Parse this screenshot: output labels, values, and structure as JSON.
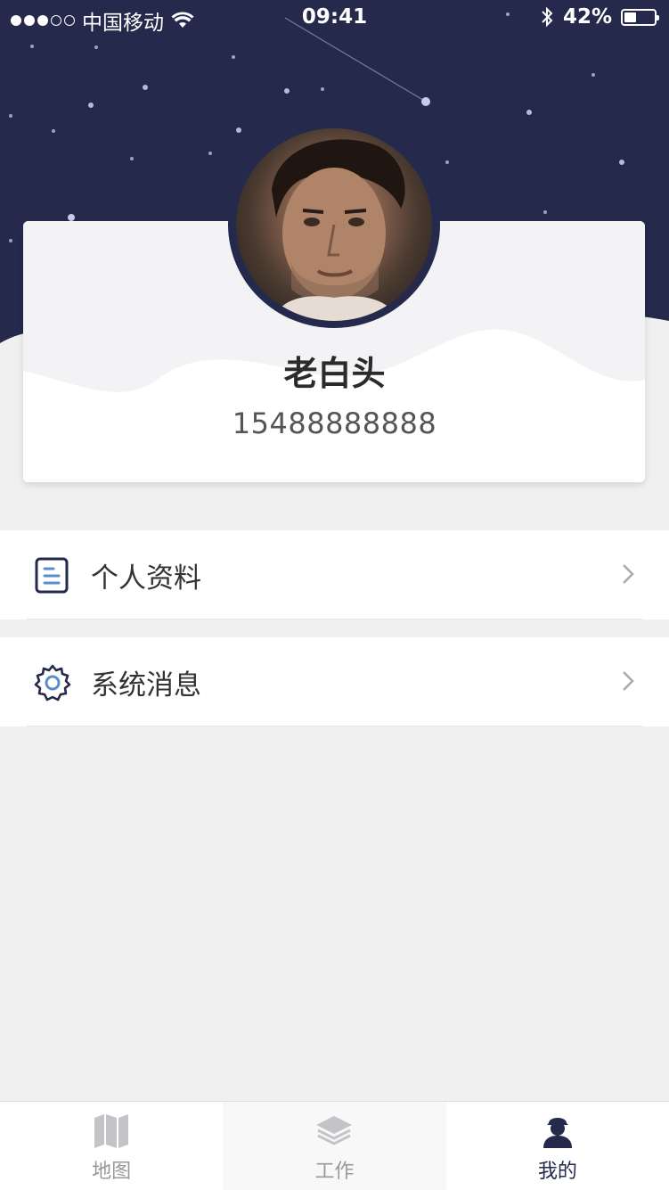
{
  "status_bar": {
    "carrier": "中国移动",
    "time": "09:41",
    "battery_percent": "42%",
    "battery_level": 0.42
  },
  "profile": {
    "name": "老白头",
    "phone": "15488888888"
  },
  "menu": [
    {
      "label": "个人资料",
      "icon": "document-icon"
    },
    {
      "label": "系统消息",
      "icon": "gear-icon"
    }
  ],
  "tab_bar": {
    "tabs": [
      {
        "label": "地图",
        "icon": "map-icon",
        "active": false
      },
      {
        "label": "工作",
        "icon": "layers-icon",
        "active": false
      },
      {
        "label": "我的",
        "icon": "user-icon",
        "active": true
      }
    ]
  },
  "colors": {
    "header_bg": "#252a4d",
    "page_bg": "#f0f0f0",
    "active_tab": "#252a4d",
    "inactive_tab": "#999999"
  }
}
